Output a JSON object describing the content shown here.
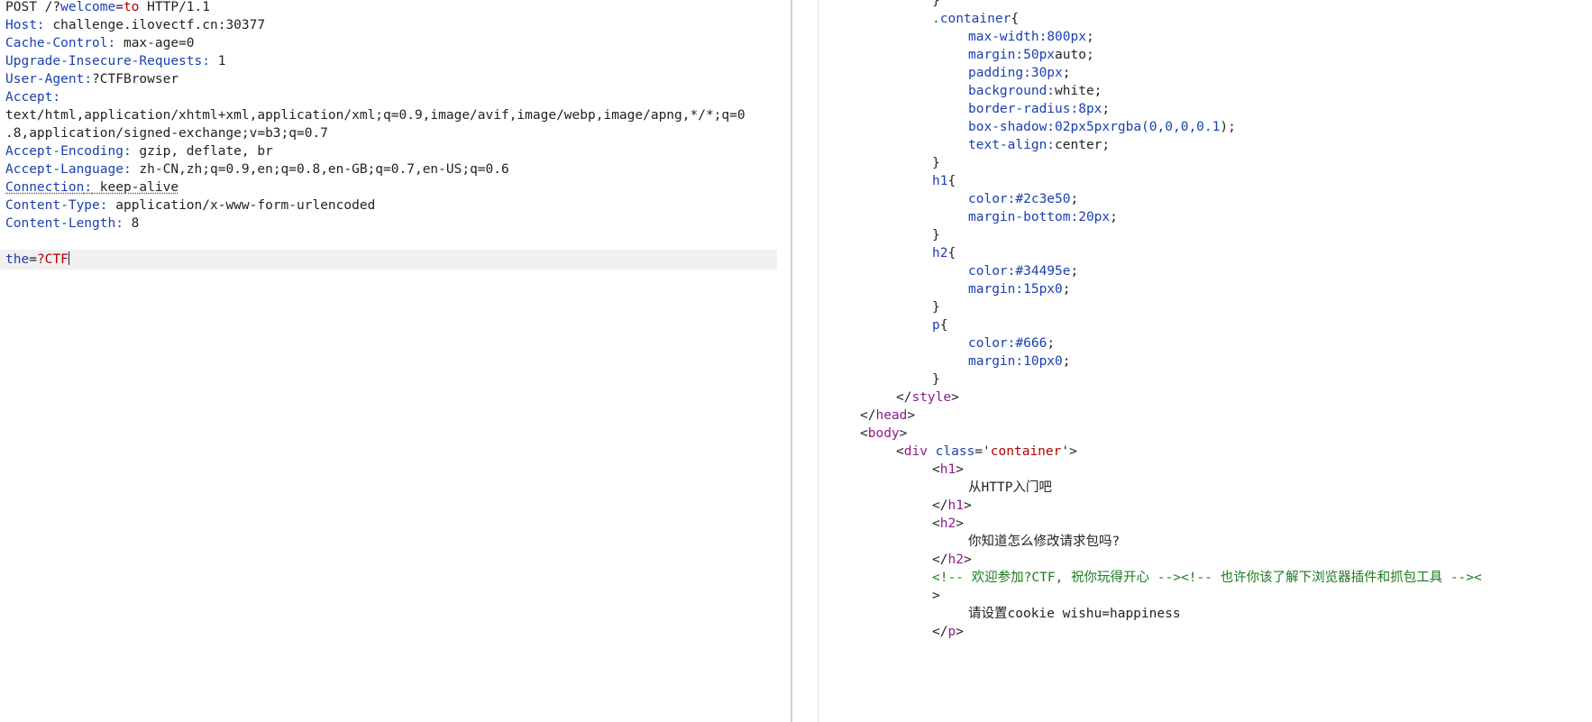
{
  "request": {
    "request_line": {
      "method": "POST /?",
      "param_key": "welcome",
      "eq": "=",
      "param_value": "to",
      "protocol": " HTTP/1.1"
    },
    "headers": [
      {
        "key": "Host",
        "value": " challenge.ilovectf.cn:30377"
      },
      {
        "key": "Cache-Control",
        "value": " max-age=0"
      },
      {
        "key": "Upgrade-Insecure-Requests",
        "value": " 1"
      },
      {
        "key": "User-Agent",
        "value": "?CTFBrowser"
      },
      {
        "key": "Accept",
        "value": ""
      }
    ],
    "accept_cont1": "text/html,application/xhtml+xml,application/xml;q=0.9,image/avif,image/webp,image/apng,*/*;q=0",
    "accept_cont2": ".8,application/signed-exchange;v=b3;q=0.7",
    "headers2": [
      {
        "key": "Accept-Encoding",
        "value": " gzip, deflate, br"
      },
      {
        "key": "Accept-Language",
        "value": " zh-CN,zh;q=0.9,en;q=0.8,en-GB;q=0.7,en-US;q=0.6"
      },
      {
        "key": "Connection",
        "value": " keep-alive"
      },
      {
        "key": "Content-Type",
        "value": " application/x-www-form-urlencoded"
      },
      {
        "key": "Content-Length",
        "value": " 8"
      }
    ],
    "body": {
      "key": "the",
      "eq": "=",
      "value": "?CTF"
    }
  },
  "response": {
    "lines": [
      {
        "indent": 4,
        "parts": [
          {
            "c": "txt",
            "t": "}"
          }
        ]
      },
      {
        "indent": 4,
        "parts": [
          {
            "c": "blue",
            "t": ".container"
          },
          {
            "c": "txt",
            "t": "{"
          }
        ]
      },
      {
        "indent": 5,
        "parts": [
          {
            "c": "blue",
            "t": "max-width:"
          },
          {
            "c": "blue",
            "t": "800px"
          },
          {
            "c": "txt",
            "t": ";"
          }
        ]
      },
      {
        "indent": 5,
        "parts": [
          {
            "c": "blue",
            "t": "margin:"
          },
          {
            "c": "blue",
            "t": "50px"
          },
          {
            "c": "txt",
            "t": "auto;"
          }
        ]
      },
      {
        "indent": 5,
        "parts": [
          {
            "c": "blue",
            "t": "padding:"
          },
          {
            "c": "blue",
            "t": "30px"
          },
          {
            "c": "txt",
            "t": ";"
          }
        ]
      },
      {
        "indent": 5,
        "parts": [
          {
            "c": "blue",
            "t": "background:"
          },
          {
            "c": "txt",
            "t": "white;"
          }
        ]
      },
      {
        "indent": 5,
        "parts": [
          {
            "c": "blue",
            "t": "border-radius:"
          },
          {
            "c": "blue",
            "t": "8px"
          },
          {
            "c": "txt",
            "t": ";"
          }
        ]
      },
      {
        "indent": 5,
        "parts": [
          {
            "c": "blue",
            "t": "box-shadow:"
          },
          {
            "c": "blue",
            "t": "02px5pxrgba("
          },
          {
            "c": "blue",
            "t": "0,0,0,0.1"
          },
          {
            "c": "txt",
            "t": ");"
          }
        ]
      },
      {
        "indent": 5,
        "parts": [
          {
            "c": "blue",
            "t": "text-align:"
          },
          {
            "c": "txt",
            "t": "center;"
          }
        ]
      },
      {
        "indent": 4,
        "parts": [
          {
            "c": "txt",
            "t": "}"
          }
        ]
      },
      {
        "indent": 4,
        "parts": [
          {
            "c": "blue",
            "t": "h1"
          },
          {
            "c": "txt",
            "t": "{"
          }
        ]
      },
      {
        "indent": 5,
        "parts": [
          {
            "c": "blue",
            "t": "color:"
          },
          {
            "c": "blue",
            "t": "#2c3e50"
          },
          {
            "c": "txt",
            "t": ";"
          }
        ]
      },
      {
        "indent": 5,
        "parts": [
          {
            "c": "blue",
            "t": "margin-bottom:"
          },
          {
            "c": "blue",
            "t": "20px"
          },
          {
            "c": "txt",
            "t": ";"
          }
        ]
      },
      {
        "indent": 4,
        "parts": [
          {
            "c": "txt",
            "t": "}"
          }
        ]
      },
      {
        "indent": 4,
        "parts": [
          {
            "c": "blue",
            "t": "h2"
          },
          {
            "c": "txt",
            "t": "{"
          }
        ]
      },
      {
        "indent": 5,
        "parts": [
          {
            "c": "blue",
            "t": "color:"
          },
          {
            "c": "blue",
            "t": "#34495e"
          },
          {
            "c": "txt",
            "t": ";"
          }
        ]
      },
      {
        "indent": 5,
        "parts": [
          {
            "c": "blue",
            "t": "margin:"
          },
          {
            "c": "blue",
            "t": "15px0"
          },
          {
            "c": "txt",
            "t": ";"
          }
        ]
      },
      {
        "indent": 4,
        "parts": [
          {
            "c": "txt",
            "t": "}"
          }
        ]
      },
      {
        "indent": 4,
        "parts": [
          {
            "c": "blue",
            "t": "p"
          },
          {
            "c": "txt",
            "t": "{"
          }
        ]
      },
      {
        "indent": 5,
        "parts": [
          {
            "c": "blue",
            "t": "color:"
          },
          {
            "c": "blue",
            "t": "#666"
          },
          {
            "c": "txt",
            "t": ";"
          }
        ]
      },
      {
        "indent": 5,
        "parts": [
          {
            "c": "blue",
            "t": "margin:"
          },
          {
            "c": "blue",
            "t": "10px0"
          },
          {
            "c": "txt",
            "t": ";"
          }
        ]
      },
      {
        "indent": 4,
        "parts": [
          {
            "c": "txt",
            "t": "}"
          }
        ]
      },
      {
        "indent": 3,
        "parts": [
          {
            "c": "txt",
            "t": "</"
          },
          {
            "c": "purple",
            "t": "style"
          },
          {
            "c": "txt",
            "t": ">"
          }
        ]
      },
      {
        "indent": 2,
        "parts": [
          {
            "c": "txt",
            "t": "</"
          },
          {
            "c": "purple",
            "t": "head"
          },
          {
            "c": "txt",
            "t": ">"
          }
        ]
      },
      {
        "indent": 2,
        "parts": [
          {
            "c": "txt",
            "t": "<"
          },
          {
            "c": "purple",
            "t": "body"
          },
          {
            "c": "txt",
            "t": ">"
          }
        ]
      },
      {
        "indent": 3,
        "parts": [
          {
            "c": "txt",
            "t": "<"
          },
          {
            "c": "purple",
            "t": "div"
          },
          {
            "c": "txt",
            "t": " "
          },
          {
            "c": "blue",
            "t": "class"
          },
          {
            "c": "txt",
            "t": "='"
          },
          {
            "c": "red",
            "t": "container"
          },
          {
            "c": "txt",
            "t": "'>"
          }
        ]
      },
      {
        "indent": 4,
        "parts": [
          {
            "c": "txt",
            "t": "<"
          },
          {
            "c": "purple",
            "t": "h1"
          },
          {
            "c": "txt",
            "t": ">"
          }
        ]
      },
      {
        "indent": 5,
        "parts": [
          {
            "c": "txt",
            "t": "从HTTP入门吧"
          }
        ]
      },
      {
        "indent": 4,
        "parts": [
          {
            "c": "txt",
            "t": "</"
          },
          {
            "c": "purple",
            "t": "h1"
          },
          {
            "c": "txt",
            "t": ">"
          }
        ]
      },
      {
        "indent": 4,
        "parts": [
          {
            "c": "txt",
            "t": "<"
          },
          {
            "c": "purple",
            "t": "h2"
          },
          {
            "c": "txt",
            "t": ">"
          }
        ]
      },
      {
        "indent": 5,
        "parts": [
          {
            "c": "txt",
            "t": "你知道怎么修改请求包吗?"
          }
        ]
      },
      {
        "indent": 4,
        "parts": [
          {
            "c": "txt",
            "t": "</"
          },
          {
            "c": "purple",
            "t": "h2"
          },
          {
            "c": "txt",
            "t": ">"
          }
        ]
      },
      {
        "indent": 4,
        "parts": [
          {
            "c": "cmt",
            "t": "<!-- 欢迎参加?CTF, 祝你玩得开心 --><!-- 也许你该了解下浏览器插件和抓包工具 --><"
          }
        ]
      },
      {
        "indent": 4,
        "parts": [
          {
            "c": "txt",
            "t": ">"
          }
        ]
      },
      {
        "indent": 5,
        "parts": [
          {
            "c": "txt",
            "t": "请设置cookie wishu=happiness"
          }
        ]
      },
      {
        "indent": 4,
        "parts": [
          {
            "c": "txt",
            "t": "</"
          },
          {
            "c": "purple",
            "t": "p"
          },
          {
            "c": "txt",
            "t": ">"
          }
        ]
      }
    ]
  }
}
